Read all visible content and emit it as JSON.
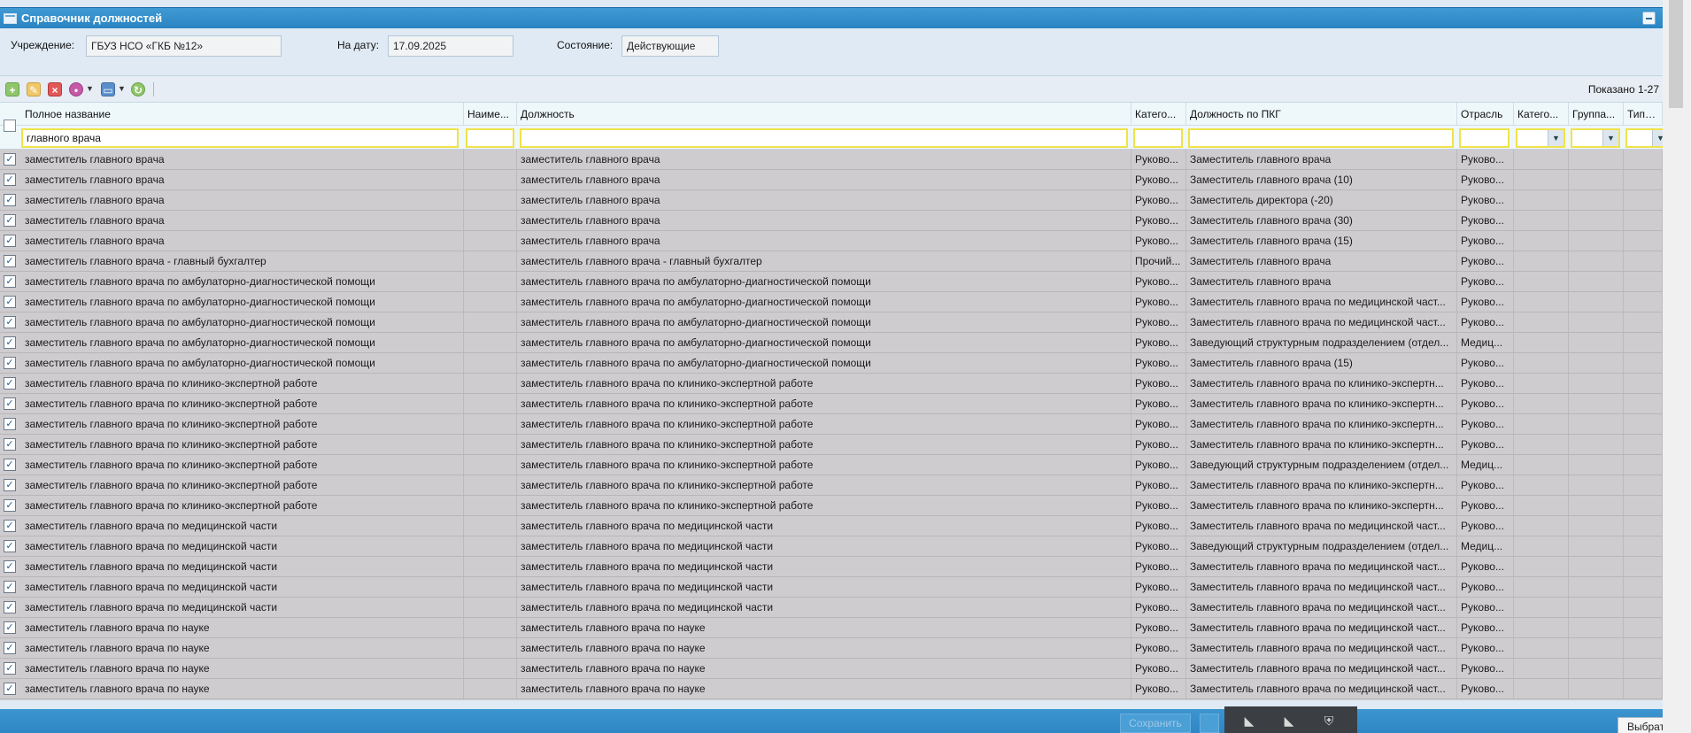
{
  "window": {
    "title": "Справочник должностей"
  },
  "filters": {
    "institution_label": "Учреждение:",
    "institution_value": "ГБУЗ НСО «ГКБ №12»",
    "date_label": "На дату:",
    "date_value": "17.09.2025",
    "state_label": "Состояние:",
    "state_value": "Действующие"
  },
  "toolbar": {
    "add_icon": "plus-icon",
    "edit_icon": "pencil-icon",
    "delete_icon": "x-icon",
    "view_icon": "eye-icon",
    "print_icon": "printer-icon",
    "refresh_icon": "refresh-icon",
    "shown_text": "Показано 1-27"
  },
  "columns": [
    {
      "label": "Полное название"
    },
    {
      "label": "Наиме..."
    },
    {
      "label": "Должность"
    },
    {
      "label": "Катего..."
    },
    {
      "label": "Должность по ПКГ"
    },
    {
      "label": "Отрасль"
    },
    {
      "label": "Катего..."
    },
    {
      "label": "Группа..."
    },
    {
      "label": "Тип до..."
    }
  ],
  "filter_row": {
    "full_name": "главного врача",
    "short_name": "",
    "position": "",
    "category": "",
    "pkg": "",
    "industry": ""
  },
  "rows": [
    {
      "full": "заместитель главного врача",
      "pos": "заместитель главного врача",
      "cat": "Руково...",
      "pkg": "Заместитель главного врача",
      "ind": "Руково..."
    },
    {
      "full": "заместитель главного врача",
      "pos": "заместитель главного врача",
      "cat": "Руково...",
      "pkg": "Заместитель главного врача (10)",
      "ind": "Руково..."
    },
    {
      "full": "заместитель главного врача",
      "pos": "заместитель главного врача",
      "cat": "Руково...",
      "pkg": "Заместитель директора (-20)",
      "ind": "Руково..."
    },
    {
      "full": "заместитель главного врача",
      "pos": "заместитель главного врача",
      "cat": "Руково...",
      "pkg": "Заместитель главного врача (30)",
      "ind": "Руково..."
    },
    {
      "full": "заместитель главного врача",
      "pos": "заместитель главного врача",
      "cat": "Руково...",
      "pkg": "Заместитель главного врача (15)",
      "ind": "Руково..."
    },
    {
      "full": "заместитель главного врача - главный бухгалтер",
      "pos": "заместитель главного врача - главный бухгалтер",
      "cat": "Прочий...",
      "pkg": "Заместитель главного врача",
      "ind": "Руково..."
    },
    {
      "full": "заместитель главного врача по амбулаторно-диагностической помощи",
      "pos": "заместитель главного врача по амбулаторно-диагностической помощи",
      "cat": "Руково...",
      "pkg": "Заместитель главного врача",
      "ind": "Руково..."
    },
    {
      "full": "заместитель главного врача по амбулаторно-диагностической помощи",
      "pos": "заместитель главного врача по амбулаторно-диагностической помощи",
      "cat": "Руково...",
      "pkg": "Заместитель главного врача по медицинской част...",
      "ind": "Руково..."
    },
    {
      "full": "заместитель главного врача по амбулаторно-диагностической помощи",
      "pos": "заместитель главного врача по амбулаторно-диагностической помощи",
      "cat": "Руково...",
      "pkg": "Заместитель главного врача по медицинской част...",
      "ind": "Руково..."
    },
    {
      "full": "заместитель главного врача по амбулаторно-диагностической помощи",
      "pos": "заместитель главного врача по амбулаторно-диагностической помощи",
      "cat": "Руково...",
      "pkg": "Заведующий структурным подразделением (отдел...",
      "ind": "Медиц..."
    },
    {
      "full": "заместитель главного врача по амбулаторно-диагностической помощи",
      "pos": "заместитель главного врача по амбулаторно-диагностической помощи",
      "cat": "Руково...",
      "pkg": "Заместитель главного врача (15)",
      "ind": "Руково..."
    },
    {
      "full": "заместитель главного врача по клинико-экспертной работе",
      "pos": "заместитель главного врача по клинико-экспертной работе",
      "cat": "Руково...",
      "pkg": "Заместитель главного врача по клинико-экспертн...",
      "ind": "Руково..."
    },
    {
      "full": "заместитель главного врача по клинико-экспертной работе",
      "pos": "заместитель главного врача по клинико-экспертной работе",
      "cat": "Руково...",
      "pkg": "Заместитель главного врача по клинико-экспертн...",
      "ind": "Руково..."
    },
    {
      "full": "заместитель главного врача по клинико-экспертной работе",
      "pos": "заместитель главного врача по клинико-экспертной работе",
      "cat": "Руково...",
      "pkg": "Заместитель главного врача по клинико-экспертн...",
      "ind": "Руково..."
    },
    {
      "full": "заместитель главного врача по клинико-экспертной работе",
      "pos": "заместитель главного врача по клинико-экспертной работе",
      "cat": "Руково...",
      "pkg": "Заместитель главного врача по клинико-экспертн...",
      "ind": "Руково..."
    },
    {
      "full": "заместитель главного врача по клинико-экспертной работе",
      "pos": "заместитель главного врача по клинико-экспертной работе",
      "cat": "Руково...",
      "pkg": "Заведующий структурным подразделением (отдел...",
      "ind": "Медиц..."
    },
    {
      "full": "заместитель главного врача по клинико-экспертной работе",
      "pos": "заместитель главного врача по клинико-экспертной работе",
      "cat": "Руково...",
      "pkg": "Заместитель главного врача по клинико-экспертн...",
      "ind": "Руково..."
    },
    {
      "full": "заместитель главного врача по клинико-экспертной работе",
      "pos": "заместитель главного врача по клинико-экспертной работе",
      "cat": "Руково...",
      "pkg": "Заместитель главного врача по клинико-экспертн...",
      "ind": "Руково..."
    },
    {
      "full": "заместитель главного врача по медицинской части",
      "pos": "заместитель главного врача по медицинской части",
      "cat": "Руково...",
      "pkg": "Заместитель главного врача по медицинской част...",
      "ind": "Руково..."
    },
    {
      "full": "заместитель главного врача по медицинской части",
      "pos": "заместитель главного врача по медицинской части",
      "cat": "Руково...",
      "pkg": "Заведующий структурным подразделением (отдел...",
      "ind": "Медиц..."
    },
    {
      "full": "заместитель главного врача по медицинской части",
      "pos": "заместитель главного врача по медицинской части",
      "cat": "Руково...",
      "pkg": "Заместитель главного врача по медицинской част...",
      "ind": "Руково..."
    },
    {
      "full": "заместитель главного врача по медицинской части",
      "pos": "заместитель главного врача по медицинской части",
      "cat": "Руково...",
      "pkg": "Заместитель главного врача по медицинской част...",
      "ind": "Руково..."
    },
    {
      "full": "заместитель главного врача по медицинской части",
      "pos": "заместитель главного врача по медицинской части",
      "cat": "Руково...",
      "pkg": "Заместитель главного врача по медицинской част...",
      "ind": "Руково..."
    },
    {
      "full": "заместитель главного врача по науке",
      "pos": "заместитель главного врача по науке",
      "cat": "Руково...",
      "pkg": "Заместитель главного врача по медицинской част...",
      "ind": "Руково..."
    },
    {
      "full": "заместитель главного врача по науке",
      "pos": "заместитель главного врача по науке",
      "cat": "Руково...",
      "pkg": "Заместитель главного врача по медицинской част...",
      "ind": "Руково..."
    },
    {
      "full": "заместитель главного врача по науке",
      "pos": "заместитель главного врача по науке",
      "cat": "Руково...",
      "pkg": "Заместитель главного врача по медицинской част...",
      "ind": "Руково..."
    },
    {
      "full": "заместитель главного врача по науке",
      "pos": "заместитель главного врача по науке",
      "cat": "Руково...",
      "pkg": "Заместитель главного врача по медицинской част...",
      "ind": "Руково..."
    }
  ],
  "footer": {
    "save_label": "Сохранить",
    "select_label": "Выбрать"
  },
  "colors": {
    "titlebar": "#2a84c3",
    "filter_highlight": "#f0e24a",
    "selected_row": "#cfccd0"
  }
}
